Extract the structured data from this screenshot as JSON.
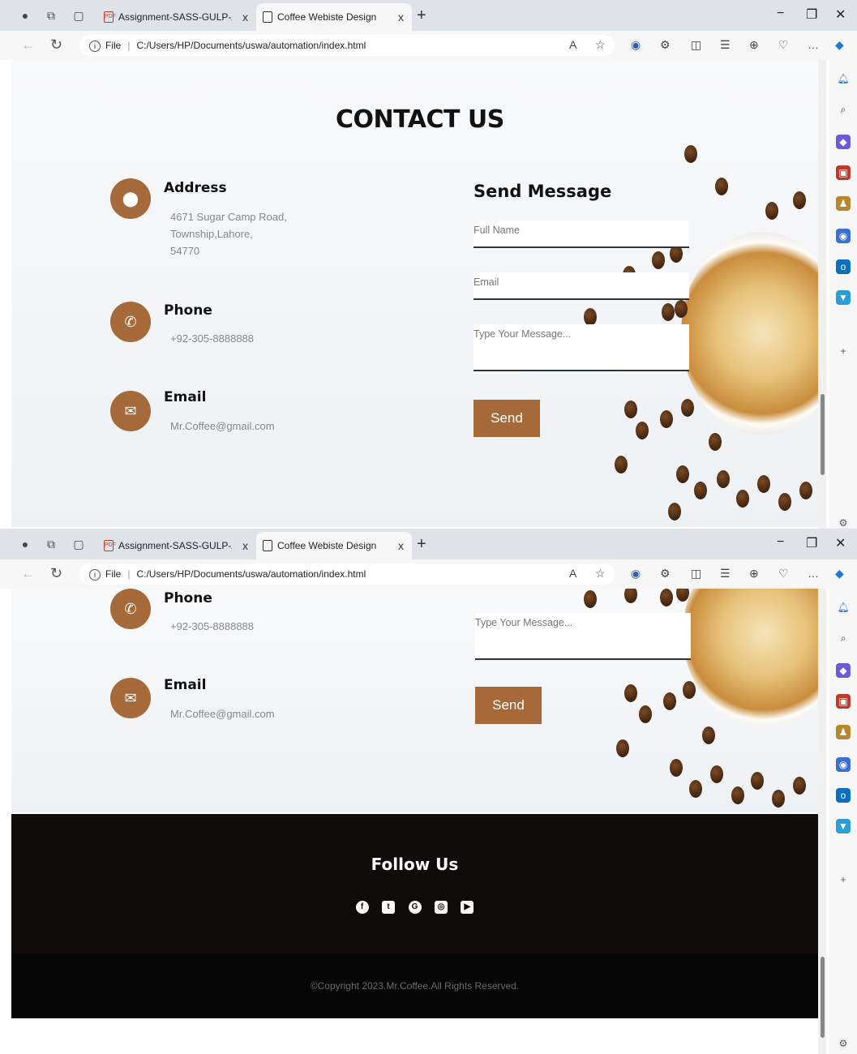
{
  "browser": {
    "tabs": [
      {
        "title": "Assignment-SASS-GULP-AUTOM"
      },
      {
        "title": "Coffee Webiste Design"
      }
    ],
    "url_prefix": "File",
    "url": "C:/Users/HP/Documents/uswa/automation/index.html",
    "tab_close": "x",
    "new_tab": "+",
    "window_controls": [
      "−",
      "❐",
      "✕"
    ]
  },
  "contact": {
    "title": "CONTACT US",
    "address": {
      "title": "Address",
      "lines": [
        "4671 Sugar Camp Road,",
        "Township,Lahore,",
        "54770"
      ],
      "icon": "map-pin-icon"
    },
    "phone": {
      "title": "Phone",
      "value": "+92-305-8888888",
      "icon": "phone-icon"
    },
    "email": {
      "title": "Email",
      "value": "Mr.Coffee@gmail.com",
      "icon": "envelope-icon"
    }
  },
  "form": {
    "title": "Send Message",
    "full_name_placeholder": "Full Name",
    "email_placeholder": "Email",
    "message_placeholder": "Type Your Message...",
    "send_label": "Send"
  },
  "footer": {
    "follow_title": "Follow Us",
    "socials": [
      "facebook-icon",
      "twitter-icon",
      "google-icon",
      "instagram-icon",
      "youtube-icon"
    ],
    "copyright": "©Copyright 2023.Mr.Coffee.All Rights Reserved."
  },
  "colors": {
    "accent": "#a5693a",
    "footer_bg": "#0e0b0a",
    "copyright_bg": "#050505"
  }
}
